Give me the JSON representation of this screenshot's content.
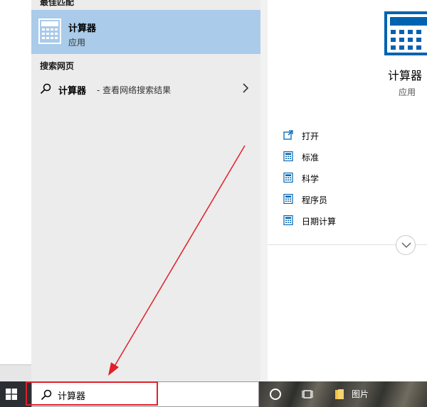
{
  "results": {
    "best_match_header": "最佳匹配",
    "best_match": {
      "name": "计算器",
      "type": "应用"
    },
    "web_header": "搜索网页",
    "web_suggestion": {
      "query": "计算器",
      "hint": "- 查看网络搜索结果"
    }
  },
  "detail": {
    "title": "计算器",
    "subtitle": "应用",
    "actions": [
      {
        "label": "打开",
        "icon": "open-icon"
      },
      {
        "label": "标准",
        "icon": "calculator-icon"
      },
      {
        "label": "科学",
        "icon": "calculator-icon"
      },
      {
        "label": "程序员",
        "icon": "calculator-icon"
      },
      {
        "label": "日期计算",
        "icon": "calculator-icon"
      }
    ]
  },
  "taskbar": {
    "search_text": "计算器",
    "pinned_folder_label": "图片"
  },
  "colors": {
    "accent": "#0063b1",
    "selection": "#aacbe9",
    "annotation": "#e0202a"
  }
}
